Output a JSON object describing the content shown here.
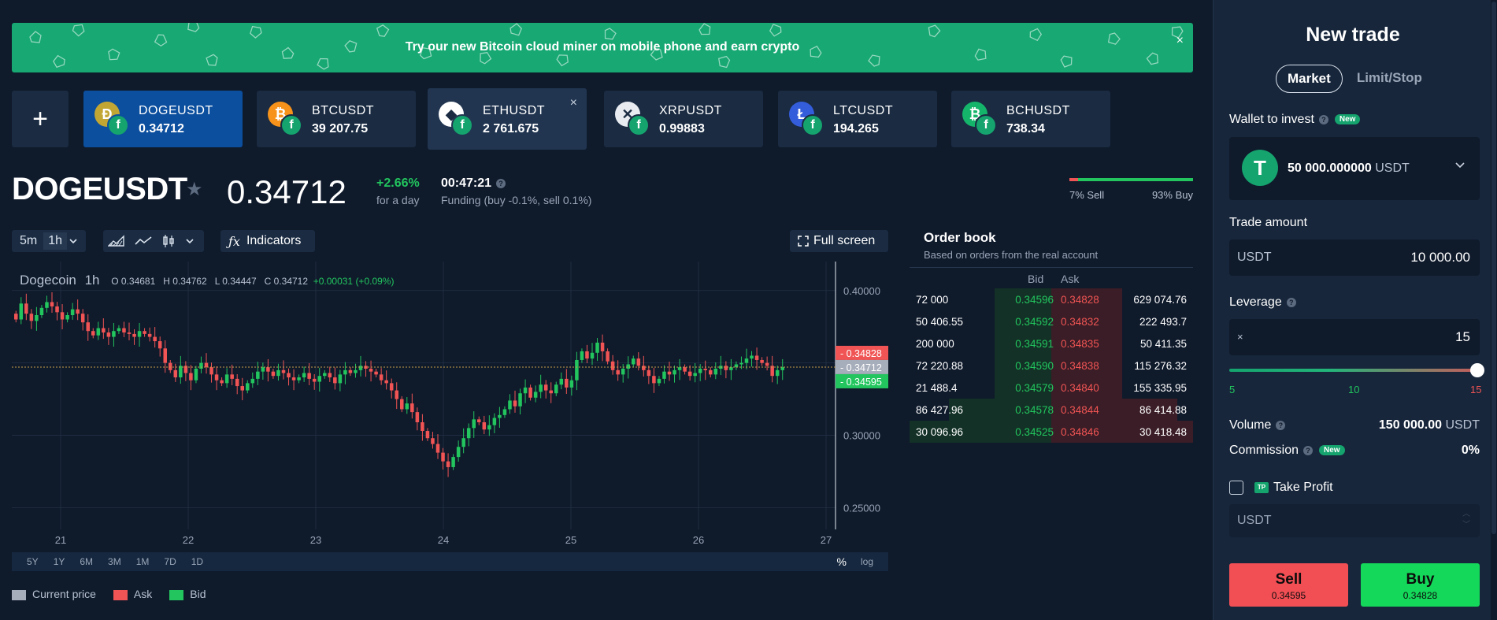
{
  "banner": {
    "text": "Try our new Bitcoin cloud miner on mobile phone and earn crypto",
    "close": "×"
  },
  "tabs": [
    {
      "symbol": "DOGEUSDT",
      "price": "0.34712",
      "coin_glyph": "Ð",
      "coin_color": "#c2a633",
      "active": true
    },
    {
      "symbol": "BTCUSDT",
      "price": "39 207.75",
      "coin_glyph": "₿",
      "coin_color": "#f7931a"
    },
    {
      "symbol": "ETHUSDT",
      "price": "2 761.675",
      "coin_glyph": "◆",
      "coin_color": "#ffffff",
      "hover": true,
      "close": "×"
    },
    {
      "symbol": "XRPUSDT",
      "price": "0.99883",
      "coin_glyph": "✕",
      "coin_color": "#e8ecf1"
    },
    {
      "symbol": "LTCUSDT",
      "price": "194.265",
      "coin_glyph": "Ł",
      "coin_color": "#345ddb"
    },
    {
      "symbol": "BCHUSDT",
      "price": "738.34",
      "coin_glyph": "₿",
      "coin_color": "#14b56a"
    }
  ],
  "add_tab": "+",
  "pair": {
    "title": "DOGEUSDT",
    "price": "0.34712",
    "change": "+2.66%",
    "change_sub": "for a day",
    "funding_time": "00:47:21",
    "funding_sub": "Funding (buy -0.1%, sell 0.1%)",
    "sell_pct_label": "7% Sell",
    "buy_pct_label": "93% Buy",
    "sell_pct": 0.07
  },
  "toolbar": {
    "tf": [
      "5m",
      "1h"
    ],
    "indicators": "Indicators",
    "fullscreen": "Full screen"
  },
  "chart_legend": {
    "name": "Dogecoin",
    "interval": "1h",
    "o": "O 0.34681",
    "h": "H 0.34762",
    "l": "L 0.34447",
    "c": "C 0.34712",
    "chg": "+0.00031 (+0.09%)"
  },
  "chart_data": {
    "type": "candlestick",
    "x_ticks": [
      "21",
      "22",
      "23",
      "24",
      "25",
      "26",
      "27"
    ],
    "y_ticks": [
      "0.40000",
      "0.35000",
      "0.30000",
      "0.25000"
    ],
    "ylim": [
      0.235,
      0.42
    ],
    "price_labels": {
      "ask": "0.34828",
      "current": "0.34712",
      "bid": "0.34595"
    },
    "close_series": [
      0.38,
      0.391,
      0.384,
      0.379,
      0.383,
      0.388,
      0.392,
      0.389,
      0.385,
      0.38,
      0.383,
      0.387,
      0.384,
      0.378,
      0.372,
      0.369,
      0.374,
      0.371,
      0.368,
      0.372,
      0.374,
      0.371,
      0.37,
      0.368,
      0.372,
      0.37,
      0.368,
      0.365,
      0.36,
      0.35,
      0.345,
      0.34,
      0.348,
      0.343,
      0.338,
      0.346,
      0.35,
      0.347,
      0.342,
      0.338,
      0.336,
      0.342,
      0.339,
      0.334,
      0.331,
      0.336,
      0.339,
      0.344,
      0.347,
      0.344,
      0.341,
      0.345,
      0.343,
      0.34,
      0.338,
      0.34,
      0.343,
      0.339,
      0.337,
      0.341,
      0.343,
      0.34,
      0.336,
      0.342,
      0.345,
      0.343,
      0.345,
      0.348,
      0.346,
      0.344,
      0.342,
      0.338,
      0.336,
      0.331,
      0.325,
      0.318,
      0.322,
      0.316,
      0.309,
      0.303,
      0.298,
      0.294,
      0.288,
      0.282,
      0.278,
      0.285,
      0.292,
      0.298,
      0.305,
      0.311,
      0.309,
      0.304,
      0.307,
      0.312,
      0.314,
      0.318,
      0.324,
      0.32,
      0.329,
      0.333,
      0.326,
      0.33,
      0.335,
      0.331,
      0.329,
      0.335,
      0.339,
      0.333,
      0.338,
      0.352,
      0.358,
      0.353,
      0.357,
      0.364,
      0.358,
      0.351,
      0.345,
      0.342,
      0.346,
      0.349,
      0.353,
      0.348,
      0.345,
      0.341,
      0.336,
      0.339,
      0.344,
      0.342,
      0.345,
      0.347,
      0.344,
      0.341,
      0.343,
      0.346,
      0.345,
      0.342,
      0.346,
      0.348,
      0.345,
      0.347,
      0.349,
      0.35,
      0.353,
      0.355,
      0.352,
      0.35,
      0.348,
      0.341,
      0.345,
      0.347
    ]
  },
  "range_bar": {
    "ranges": [
      "5Y",
      "1Y",
      "6M",
      "3M",
      "1M",
      "7D",
      "1D"
    ],
    "pct": "%",
    "log": "log"
  },
  "bottom_legend": [
    {
      "label": "Current price",
      "color": "#a7aebb"
    },
    {
      "label": "Ask",
      "color": "#f05454"
    },
    {
      "label": "Bid",
      "color": "#22c55e"
    }
  ],
  "order_book": {
    "title": "Order book",
    "subtitle": "Based on orders from the real account",
    "bid_header": "Bid",
    "ask_header": "Ask",
    "rows": [
      {
        "vol": "72 000",
        "bid": "0.34596",
        "ask": "0.34828",
        "avol": "629 074.76"
      },
      {
        "vol": "50 406.55",
        "bid": "0.34592",
        "ask": "0.34832",
        "avol": "222 493.7"
      },
      {
        "vol": "200 000",
        "bid": "0.34591",
        "ask": "0.34835",
        "avol": "50 411.35"
      },
      {
        "vol": "72 220.88",
        "bid": "0.34590",
        "ask": "0.34838",
        "avol": "115 276.32"
      },
      {
        "vol": "21 488.4",
        "bid": "0.34579",
        "ask": "0.34840",
        "avol": "155 335.95"
      },
      {
        "vol": "86 427.96",
        "bid": "0.34578",
        "ask": "0.34844",
        "avol": "86 414.88"
      },
      {
        "vol": "30 096.96",
        "bid": "0.34525",
        "ask": "0.34846",
        "avol": "30 418.48"
      }
    ]
  },
  "trade": {
    "title": "New trade",
    "tabs": [
      "Market",
      "Limit/Stop"
    ],
    "wallet_label": "Wallet to invest",
    "new_badge": "New",
    "wallet_amount": "50 000.000000",
    "wallet_currency": "USDT",
    "wallet_glyph": "T",
    "amount_label": "Trade amount",
    "amount_currency": "USDT",
    "amount_value": "10 000.00",
    "leverage_label": "Leverage",
    "leverage_prefix": "×",
    "leverage_value": "15",
    "leverage_ticks": [
      "5",
      "10",
      "15"
    ],
    "volume_label": "Volume",
    "volume_value": "150 000.00",
    "volume_currency": "USDT",
    "commission_label": "Commission",
    "commission_value": "0%",
    "tp_badge": "TP",
    "tp_label": "Take Profit",
    "tp_currency": "USDT",
    "sell_label": "Sell",
    "sell_price": "0.34595",
    "buy_label": "Buy",
    "buy_price": "0.34828"
  }
}
